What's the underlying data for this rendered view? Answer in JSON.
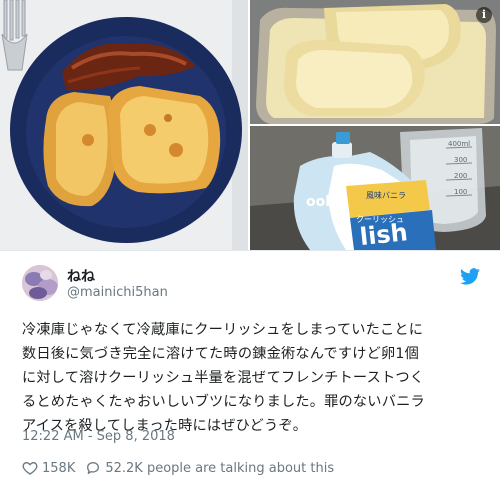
{
  "tweet": {
    "display_name": "ねね",
    "handle": "@mainichi5han",
    "text_lines": [
      "冷凍庫じゃなくて冷蔵庫にクーリッシュをしまっていたことに",
      "数日後に気づき完全に溶けてた時の錬金術なんですけど卵1個",
      "に対して溶けクーリッシュ半量を混ぜてフレンチトーストつく",
      "るとめたゃくたゃおいしいブツになりました。罪のないバニラ",
      "アイスを殺してしまった時にはぜひどうぞ。"
    ],
    "timestamp": "12:22 AM - Sep 8, 2018",
    "likes": "158K",
    "talking": "52.2K people are talking about this"
  },
  "photos": {
    "info_glyph": "i",
    "package_text_1": "ooli",
    "package_text_2": "lish",
    "package_text_3": "風味バニラ",
    "package_text_4": "クーリッシュ",
    "cup_marks": [
      "400ml",
      "300",
      "200",
      "100"
    ]
  },
  "icons": {
    "heart": "heart-icon",
    "reply": "reply-icon",
    "twitter": "twitter-bird-icon",
    "info": "info-icon"
  },
  "colors": {
    "twitter_blue": "#1da1f2",
    "handle_gray": "#697882",
    "text": "#1c2022"
  }
}
